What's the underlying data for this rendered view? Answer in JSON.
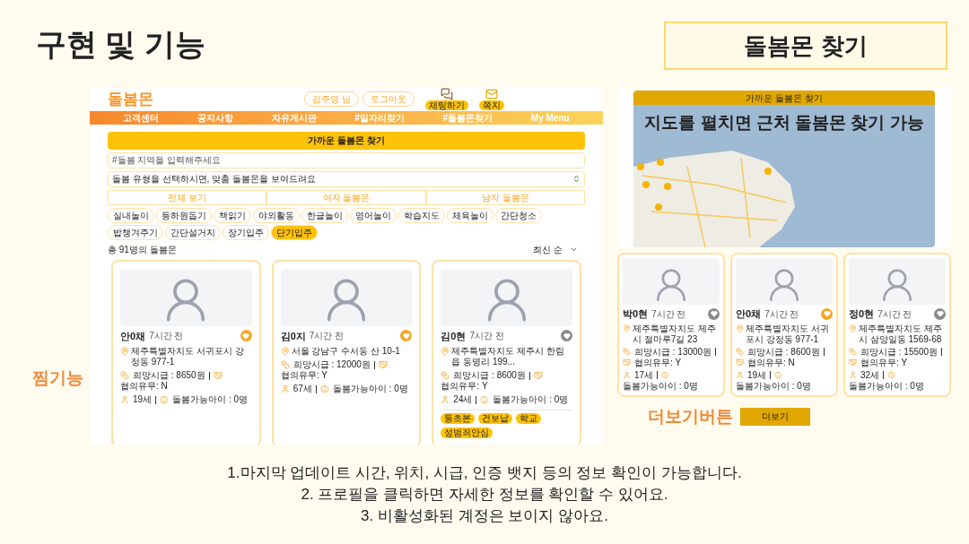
{
  "slide_title": "구현 및 기능",
  "section_badge": "돌봄몬 찾기",
  "like_callout": "찜기능",
  "more_callout": "더보기버튼",
  "list_page": {
    "header": {
      "logo": "돌봄몬",
      "user_button": "김주영 님",
      "logout_button": "로그아웃",
      "shortcuts": [
        {
          "label": "채팅하기",
          "kind": "chat"
        },
        {
          "label": "쪽지",
          "kind": "message"
        }
      ]
    },
    "nav": [
      "고객센터",
      "공지사항",
      "자유게시판",
      "#일자리찾기",
      "#돌봄몬찾기",
      "My Menu"
    ],
    "search_title": "가까운 돌봄몬 찾기",
    "region_field": {
      "placeholder": "#돌봄 지역을 입력해주세요"
    },
    "type_select": {
      "value": "돌봄 유형을 선택하시면, 맞춤 돌봄몬을 보여드려요"
    },
    "gender_filters": [
      "전체 보기",
      "여자 돌봄몬",
      "남자 돌봄몬"
    ],
    "tags": [
      {
        "label": "실내놀이",
        "selected": false
      },
      {
        "label": "등하원돕기",
        "selected": false
      },
      {
        "label": "책읽기",
        "selected": false
      },
      {
        "label": "야외활동",
        "selected": false
      },
      {
        "label": "한글놀이",
        "selected": false
      },
      {
        "label": "영어놀이",
        "selected": false
      },
      {
        "label": "학습지도",
        "selected": false
      },
      {
        "label": "체육놀이",
        "selected": false
      },
      {
        "label": "간단청소",
        "selected": false
      },
      {
        "label": "밥챙겨주기",
        "selected": false
      },
      {
        "label": "간단설거지",
        "selected": false
      },
      {
        "label": "장기입주",
        "selected": false
      },
      {
        "label": "단기입주",
        "selected": true
      }
    ],
    "count": "총 91명의 돌봄몬",
    "sort": "최신 순",
    "cards": [
      {
        "name": "안0채",
        "time": "7시간 전",
        "liked": true,
        "address": "제주특별자치도 서귀포시 강정동 977-1",
        "wage": "희망시급 : 8650원",
        "negotiable": "협의유무: N",
        "age": "19세",
        "children": "돌봄가능아이 : 0명"
      },
      {
        "name": "김0지",
        "time": "7시간 전",
        "liked": true,
        "address": "서울 강남구 수서동 산 10-1",
        "wage": "희망시급 : 12000원",
        "negotiable": "협의유무: Y",
        "age": "67세",
        "children": "돌봄가능아이 : 0명"
      },
      {
        "name": "김0현",
        "time": "7시간 전",
        "liked": false,
        "address": "제주특별자치도 제주시 한림읍 동명리 199...",
        "wage": "희망시급 : 8600원",
        "negotiable": "협의유무: Y",
        "age": "24세",
        "children": "돌봄가능아이 : 0명",
        "badges": [
          "등초본",
          "건보납",
          "학교",
          "성범죄안심"
        ]
      }
    ]
  },
  "map_page": {
    "title": "가까운 돌봄몬 찾기",
    "overlay": "지도를 펼치면 근처 돌봄몬 찾기 가능",
    "cards": [
      {
        "name": "박0현",
        "time": "7시간 전",
        "liked": false,
        "address": "제주특별자치도 제주시 절마루7길 23",
        "wage": "희망시급 : 13000원",
        "negotiable": "협의유무: Y",
        "age": "17세",
        "children": "돌봄가능아이 : 0명"
      },
      {
        "name": "안0채",
        "time": "7시간 전",
        "liked": true,
        "address": "제주특별자치도 서귀포시 강정동 977-1",
        "wage": "희망시급 : 8600원",
        "negotiable": "협의유무: N",
        "age": "19세",
        "children": "돌봄가능아이 : 0명"
      },
      {
        "name": "정0현",
        "time": "7시간 전",
        "liked": false,
        "address": "제주특별자치도 제주시 삼양일동 1569-68",
        "wage": "희망시급 : 15500원",
        "negotiable": "협의유무: Y",
        "age": "32세",
        "children": "돌봄가능아이 : 0명"
      }
    ],
    "more_button": "더보기"
  },
  "notes": [
    "1.마지막 업데이트 시간, 위치, 시급, 인증 뱃지 등의 정보 확인이 가능합니다.",
    "2. 프로필을 클릭하면 자세한 정보를 확인할 수 있어요.",
    "3. 비활성화된 계정은 보이지 않아요."
  ]
}
